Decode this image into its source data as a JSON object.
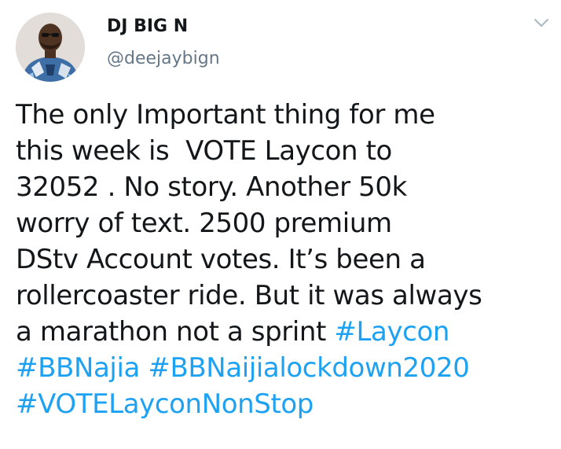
{
  "author": {
    "display_name": "DJ BIG N",
    "handle": "@deejaybign",
    "avatar_icon": "profile-photo"
  },
  "menu": {
    "icon": "chevron-down-icon"
  },
  "tweet": {
    "lines": [
      [
        {
          "text": "The only Important thing for me"
        }
      ],
      [
        {
          "text": "this week is  VOTE Laycon to"
        }
      ],
      [
        {
          "text": "32052 . No story. Another 50k"
        }
      ],
      [
        {
          "text": "worry of text. 2500 premium"
        }
      ],
      [
        {
          "text": "DStv Account votes. It’s been a"
        }
      ],
      [
        {
          "text": "rollercoaster ride. But it was always"
        }
      ],
      [
        {
          "text": "a marathon not a sprint "
        },
        {
          "text": "#Laycon",
          "hashtag": true
        }
      ],
      [
        {
          "text": "#BBNajia",
          "hashtag": true
        },
        {
          "text": " "
        },
        {
          "text": "#BBNaijialockdown2020",
          "hashtag": true
        }
      ],
      [
        {
          "text": "#VOTELayconNonStop",
          "hashtag": true
        }
      ]
    ]
  },
  "colors": {
    "text": "#14171a",
    "secondary": "#657786",
    "link": "#1da1f2",
    "chevron": "#aab8c2"
  }
}
